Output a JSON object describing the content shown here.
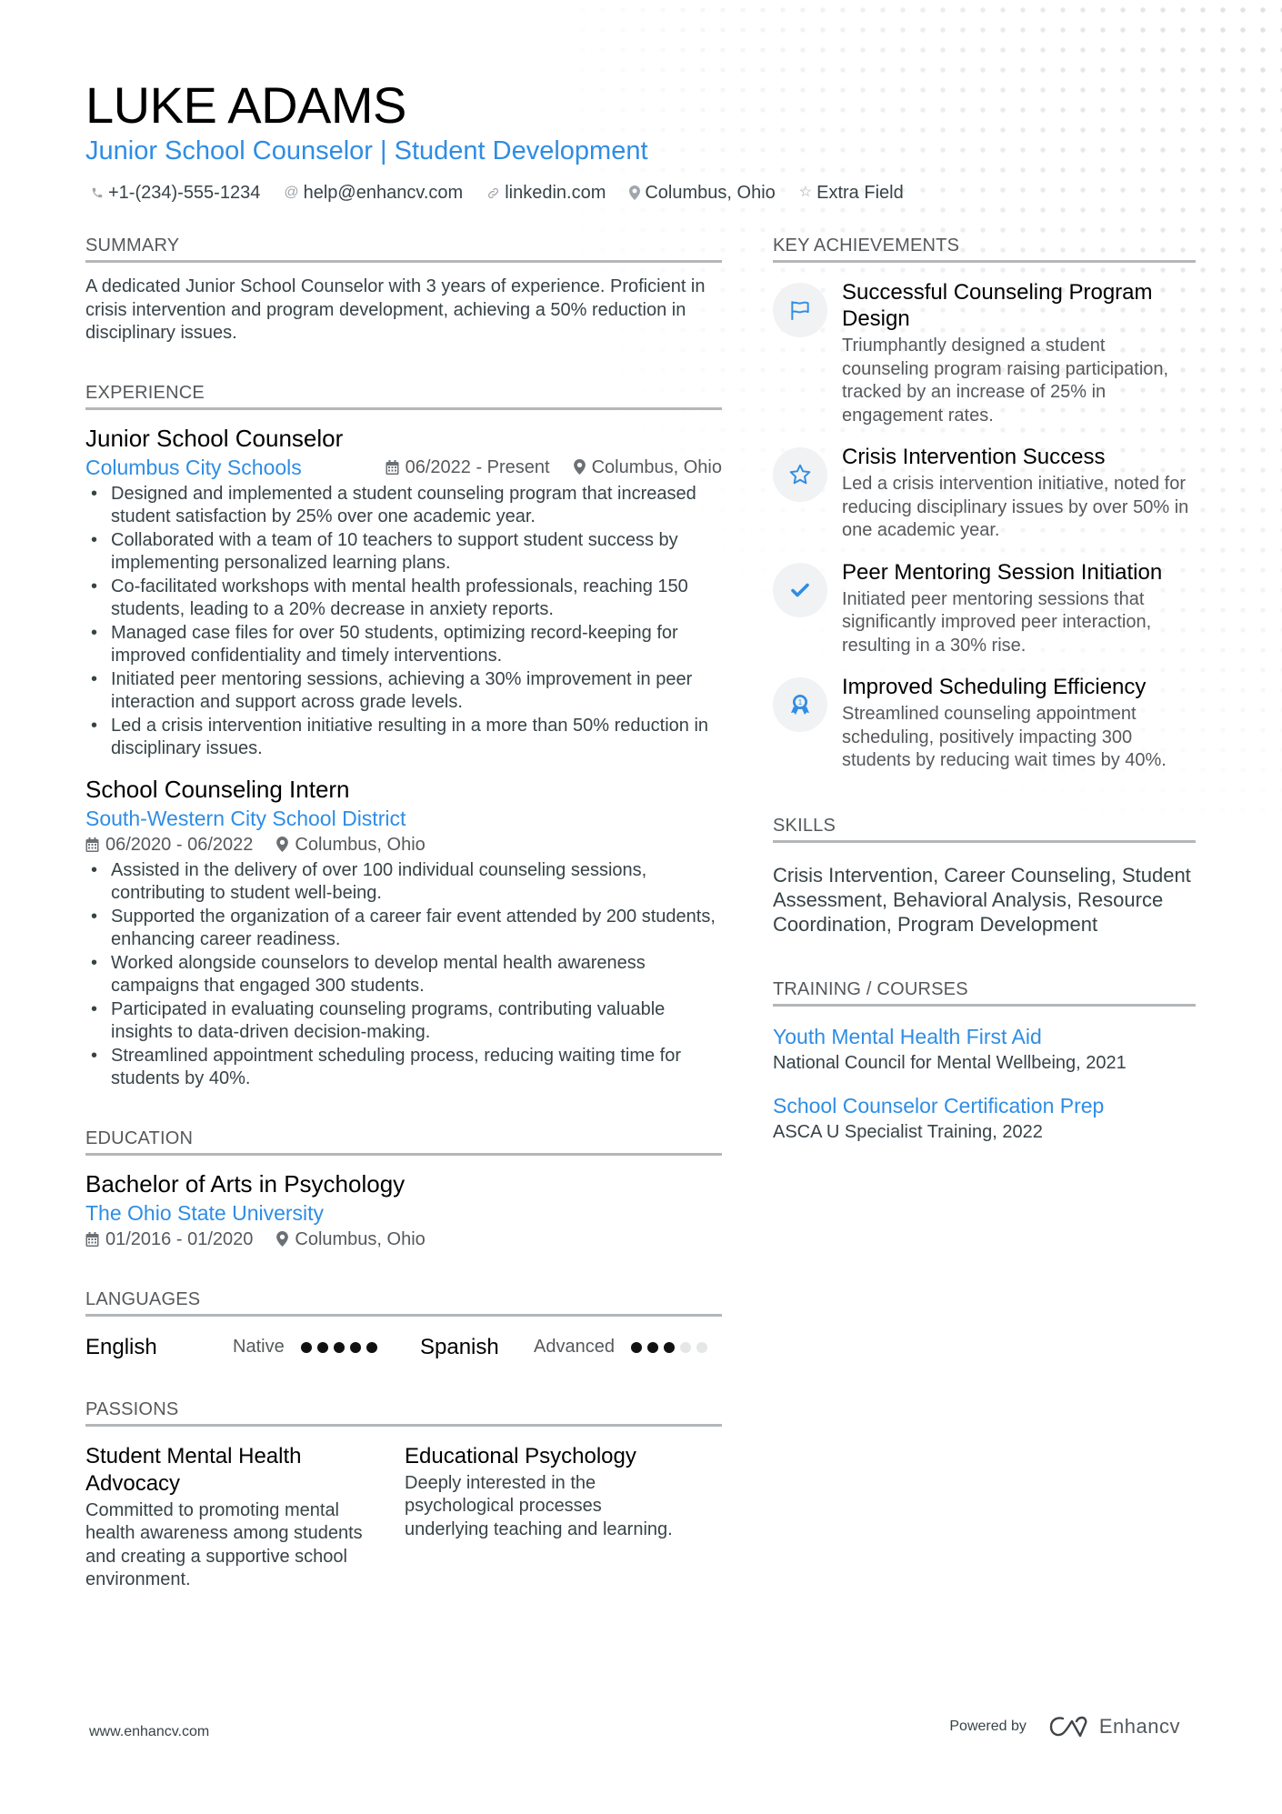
{
  "header": {
    "name": "LUKE ADAMS",
    "headline": "Junior School Counselor | Student Development",
    "contacts": [
      {
        "icon": "phone-icon",
        "text": "+1-(234)-555-1234"
      },
      {
        "icon": "at-icon",
        "text": "help@enhancv.com"
      },
      {
        "icon": "link-icon",
        "text": "linkedin.com"
      },
      {
        "icon": "location-icon",
        "text": "Columbus, Ohio"
      },
      {
        "icon": "star-icon",
        "text": "Extra Field"
      }
    ]
  },
  "summary": {
    "title": "SUMMARY",
    "text": "A dedicated Junior School Counselor with 3 years of experience. Proficient in crisis intervention and program development, achieving a 50% reduction in disciplinary issues."
  },
  "experience": {
    "title": "EXPERIENCE",
    "jobs": [
      {
        "title": "Junior School Counselor",
        "company": "Columbus City Schools",
        "dates": "06/2022 - Present",
        "location": "Columbus, Ohio",
        "bullets": [
          "Designed and implemented a student counseling program that increased student satisfaction by 25% over one academic year.",
          "Collaborated with a team of 10 teachers to support student success by implementing personalized learning plans.",
          "Co-facilitated workshops with mental health professionals, reaching 150 students, leading to a 20% decrease in anxiety reports.",
          "Managed case files for over 50 students, optimizing record-keeping for improved confidentiality and timely interventions.",
          "Initiated peer mentoring sessions, achieving a 30% improvement in peer interaction and support across grade levels.",
          "Led a crisis intervention initiative resulting in a more than 50% reduction in disciplinary issues."
        ]
      },
      {
        "title": "School Counseling Intern",
        "company": "South-Western City School District",
        "dates": "06/2020 - 06/2022",
        "location": "Columbus, Ohio",
        "bullets": [
          "Assisted in the delivery of over 100 individual counseling sessions, contributing to student well-being.",
          "Supported the organization of a career fair event attended by 200 students, enhancing career readiness.",
          "Worked alongside counselors to develop mental health awareness campaigns that engaged 300 students.",
          "Participated in evaluating counseling programs, contributing valuable insights to data-driven decision-making.",
          "Streamlined appointment scheduling process, reducing waiting time for students by 40%."
        ]
      }
    ]
  },
  "education": {
    "title": "EDUCATION",
    "degree": "Bachelor of Arts in Psychology",
    "school": "The Ohio State University",
    "dates": "01/2016 - 01/2020",
    "location": "Columbus, Ohio"
  },
  "languages": {
    "title": "LANGUAGES",
    "items": [
      {
        "name": "English",
        "level": "Native",
        "rating": 5,
        "max": 5
      },
      {
        "name": "Spanish",
        "level": "Advanced",
        "rating": 3,
        "max": 5
      }
    ]
  },
  "passions": {
    "title": "PASSIONS",
    "items": [
      {
        "title": "Student Mental Health Advocacy",
        "desc": "Committed to promoting mental health awareness among students and creating a supportive school environment."
      },
      {
        "title": "Educational Psychology",
        "desc": "Deeply interested in the psychological processes underlying teaching and learning."
      }
    ]
  },
  "achievements": {
    "title": "KEY ACHIEVEMENTS",
    "items": [
      {
        "icon": "flag-icon",
        "title": "Successful Counseling Program Design",
        "desc": "Triumphantly designed a student counseling program raising participation, tracked by an increase of 25% in engagement rates."
      },
      {
        "icon": "star-icon",
        "title": "Crisis Intervention Success",
        "desc": "Led a crisis intervention initiative, noted for reducing disciplinary issues by over 50% in one academic year."
      },
      {
        "icon": "checkmark-icon",
        "title": "Peer Mentoring Session Initiation",
        "desc": "Initiated peer mentoring sessions that significantly improved peer interaction, resulting in a 30% rise."
      },
      {
        "icon": "award-ribbon-icon",
        "title": "Improved Scheduling Efficiency",
        "desc": "Streamlined counseling appointment scheduling, positively impacting 300 students by reducing wait times by 40%."
      }
    ]
  },
  "skills": {
    "title": "SKILLS",
    "text": "Crisis Intervention, Career Counseling, Student Assessment, Behavioral Analysis, Resource Coordination, Program Development"
  },
  "training": {
    "title": "TRAINING / COURSES",
    "items": [
      {
        "title": "Youth Mental Health First Aid",
        "sub": "National Council for Mental Wellbeing, 2021"
      },
      {
        "title": "School Counselor Certification Prep",
        "sub": "ASCA U Specialist Training, 2022"
      }
    ]
  },
  "footer": {
    "website": "www.enhancv.com",
    "powered_by": "Powered by",
    "brand": "Enhancv"
  },
  "colors": {
    "accent": "#2f8de4",
    "text": "#384347",
    "heading": "#000000",
    "rule": "#b4b7ba"
  }
}
